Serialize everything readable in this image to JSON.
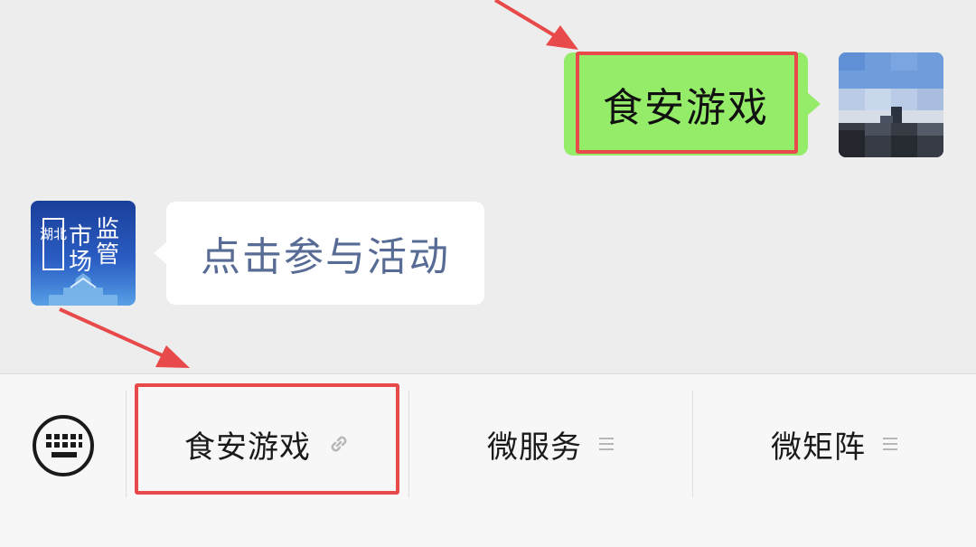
{
  "chat": {
    "sent_message": {
      "text": "食安游戏"
    },
    "received_message": {
      "text": "点击参与活动"
    },
    "official_avatar": {
      "line1": "监",
      "line2": "管",
      "line3": "市",
      "line4": "场",
      "side": "湖北"
    }
  },
  "menu": {
    "items": [
      {
        "label": "食安游戏",
        "suffix_icon": "link-icon"
      },
      {
        "label": "微服务",
        "suffix_icon": "submenu-lines-icon"
      },
      {
        "label": "微矩阵",
        "suffix_icon": "submenu-lines-icon"
      }
    ],
    "keyboard_icon": "keyboard-icon"
  },
  "colors": {
    "background": "#ededed",
    "sent_bubble": "#95ec69",
    "received_text": "#576b95",
    "highlight": "#e8494a",
    "menubar": "#f7f7f7"
  }
}
